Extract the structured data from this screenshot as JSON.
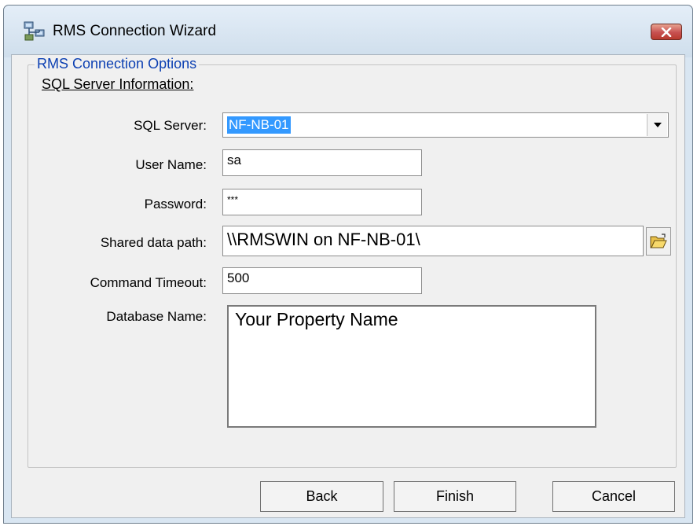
{
  "window": {
    "title": "RMS Connection Wizard",
    "icons": {
      "app": "network-computers-icon",
      "close": "close-icon"
    }
  },
  "group": {
    "legend": "RMS Connection Options",
    "section_label": "SQL Server Information:"
  },
  "fields": {
    "sql_server": {
      "label": "SQL Server:",
      "value": "NF-NB-01"
    },
    "user_name": {
      "label": "User Name:",
      "value": "sa"
    },
    "password": {
      "label": "Password:",
      "value": "***"
    },
    "shared_data_path": {
      "label": "Shared data path:",
      "value": "\\\\RMSWIN on NF-NB-01\\"
    },
    "command_timeout": {
      "label": "Command Timeout:",
      "value": "500"
    },
    "database_name": {
      "label": "Database Name:",
      "value": "Your Property Name"
    }
  },
  "buttons": {
    "back": "Back",
    "finish": "Finish",
    "cancel": "Cancel"
  },
  "colors": {
    "legend_text": "#0b3fb2",
    "selection": "#3399ff",
    "close_button": "#c75050"
  }
}
